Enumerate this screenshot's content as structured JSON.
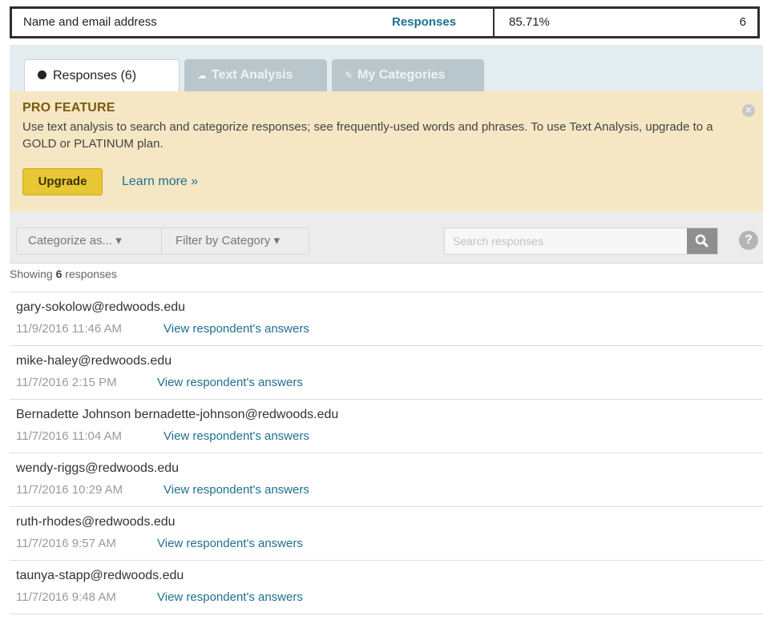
{
  "summary": {
    "question": "Name and email address",
    "responses_label": "Responses",
    "percent": "85.71%",
    "count": "6"
  },
  "tabs": [
    {
      "label": "Responses (6)",
      "icon": "dot-icon",
      "active": true
    },
    {
      "label": "Text Analysis",
      "icon": "cloud-icon",
      "active": false
    },
    {
      "label": "My Categories",
      "icon": "tag-icon",
      "active": false
    }
  ],
  "pro": {
    "title": "PRO FEATURE",
    "text": "Use text analysis to search and categorize responses; see frequently-used words and phrases. To use Text Analysis, upgrade to a GOLD or PLATINUM plan.",
    "upgrade_label": "Upgrade",
    "learn_more": "Learn more »"
  },
  "toolbar": {
    "categorize_label": "Categorize as...",
    "filter_label": "Filter by Category",
    "search_placeholder": "Search responses"
  },
  "showing": {
    "prefix": "Showing ",
    "count": "6",
    "suffix": " responses"
  },
  "responses": [
    {
      "email": "gary-sokolow@redwoods.edu",
      "time": "11/9/2016 11:46 AM",
      "link": "View respondent's answers"
    },
    {
      "email": "mike-haley@redwoods.edu",
      "time": "11/7/2016 2:15 PM",
      "link": "View respondent's answers"
    },
    {
      "email": "Bernadette Johnson bernadette-johnson@redwoods.edu",
      "time": "11/7/2016 11:04 AM",
      "link": "View respondent's answers"
    },
    {
      "email": "wendy-riggs@redwoods.edu",
      "time": "11/7/2016 10:29 AM",
      "link": "View respondent's answers"
    },
    {
      "email": "ruth-rhodes@redwoods.edu",
      "time": "11/7/2016 9:57 AM",
      "link": "View respondent's answers"
    },
    {
      "email": "taunya-stapp@redwoods.edu",
      "time": "11/7/2016 9:48 AM",
      "link": "View respondent's answers"
    }
  ]
}
